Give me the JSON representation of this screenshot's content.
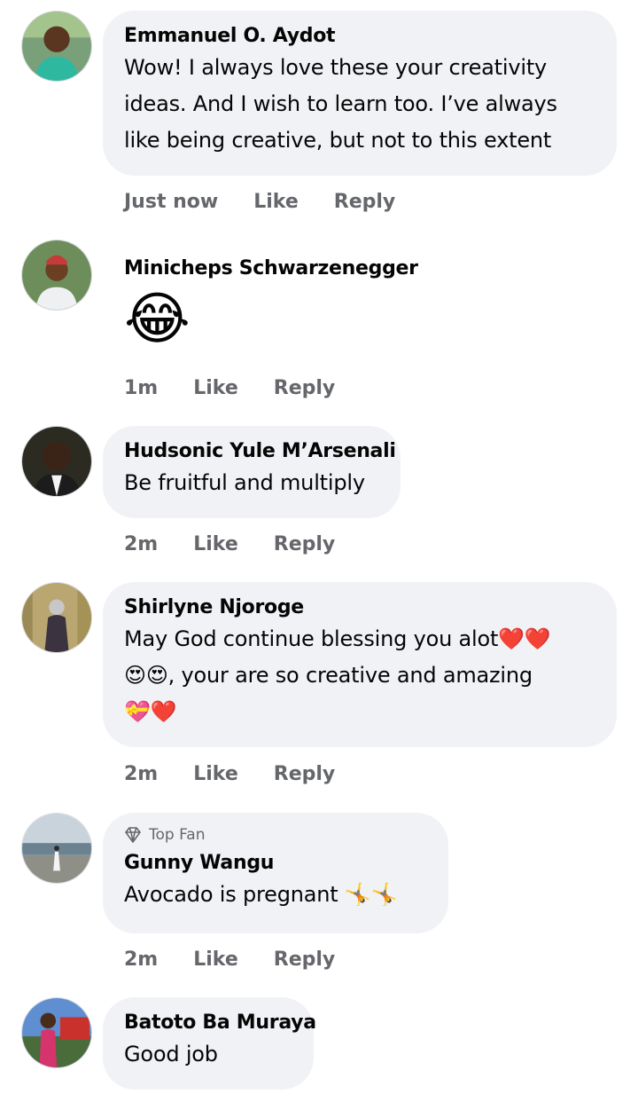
{
  "comments": [
    {
      "author": "Emmanuel O. Aydot",
      "lines": [
        "Wow! I always love these your creativity",
        "ideas. And I wish to learn too. I’ve always",
        "like being creative, but not to this extent"
      ],
      "time": "Just now",
      "like": "Like",
      "reply": "Reply"
    },
    {
      "author": "Minicheps Schwarzenegger",
      "emoji": "😂",
      "time": "1m",
      "like": "Like",
      "reply": "Reply"
    },
    {
      "author": "Hudsonic Yule M’Arsenali",
      "lines": [
        "Be fruitful and multiply"
      ],
      "time": "2m",
      "like": "Like",
      "reply": "Reply"
    },
    {
      "author": "Shirlyne Njoroge",
      "lines": [
        "May God continue blessing you alot❤️❤️",
        "😍😍, your are so creative and amazing",
        "💝❤️"
      ],
      "time": "2m",
      "like": "Like",
      "reply": "Reply"
    },
    {
      "badge": "Top Fan",
      "author": "Gunny Wangu",
      "lines": [
        "Avocado is pregnant 🤸🤸"
      ],
      "time": "2m",
      "like": "Like",
      "reply": "Reply"
    },
    {
      "author": "Batoto Ba Muraya",
      "lines": [
        "Good job"
      ]
    }
  ],
  "colors": {
    "bubble": "#f0f2f5",
    "meta": "#65676b",
    "text": "#050505"
  }
}
